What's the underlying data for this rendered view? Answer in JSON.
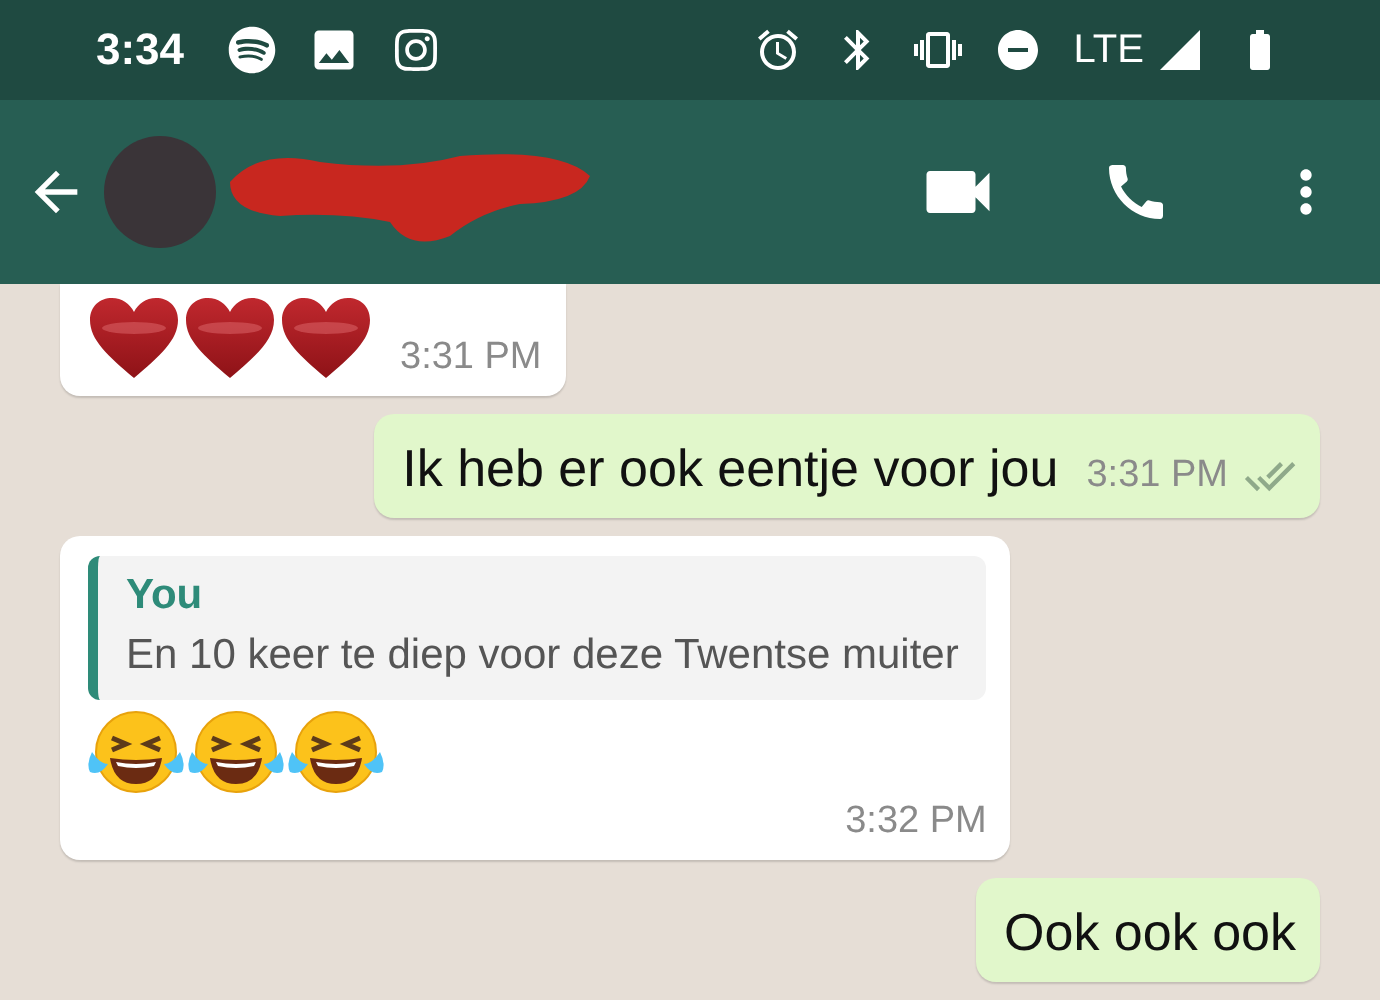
{
  "status_bar": {
    "time": "3:34",
    "network": "LTE"
  },
  "messages": [
    {
      "outgoing": false,
      "kind": "emoji",
      "emoji": [
        {
          "kind": "heart"
        },
        {
          "kind": "heart"
        },
        {
          "kind": "heart"
        }
      ],
      "time": "3:31 PM"
    },
    {
      "outgoing": true,
      "kind": "text",
      "text": "Ik heb er ook eentje voor jou",
      "time": "3:31 PM",
      "read": false
    },
    {
      "outgoing": false,
      "kind": "reply",
      "quote": {
        "author": "You",
        "text": "En 10 keer te diep voor deze Twentse muiter"
      },
      "emoji": [
        {
          "kind": "laughing"
        },
        {
          "kind": "laughing"
        },
        {
          "kind": "laughing"
        }
      ],
      "time": "3:32 PM"
    },
    {
      "outgoing": true,
      "kind": "text",
      "text": "Ook ook ook"
    }
  ]
}
